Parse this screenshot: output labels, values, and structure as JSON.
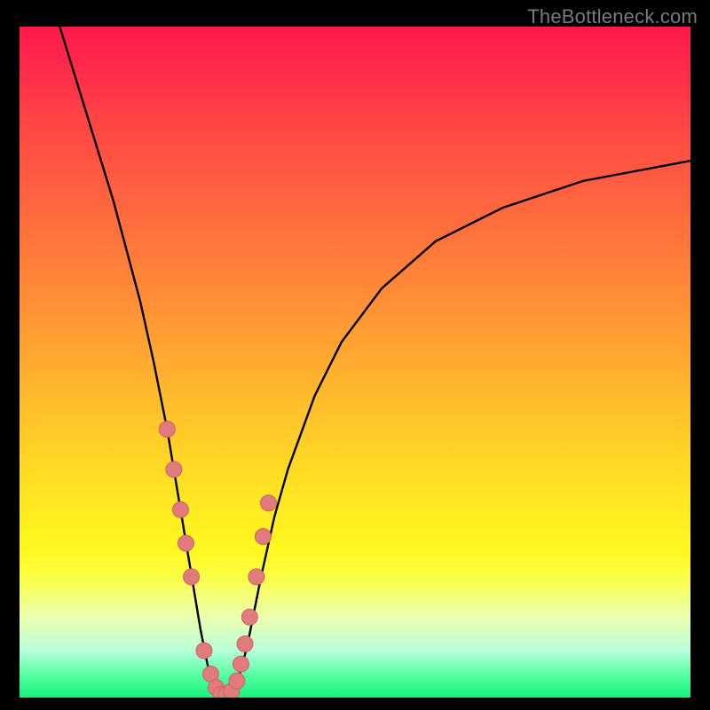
{
  "watermark": "TheBottleneck.com",
  "colors": {
    "marker_fill": "#e27b7d",
    "marker_stroke": "#cc6264",
    "curve_stroke": "#000000"
  },
  "chart_data": {
    "type": "line",
    "title": "",
    "xlabel": "",
    "ylabel": "",
    "xlim": [
      0,
      100
    ],
    "ylim": [
      0,
      100
    ],
    "grid": false,
    "series": [
      {
        "name": "curve",
        "x": [
          6,
          10,
          14,
          18,
          20,
          22,
          24,
          25,
          26,
          27,
          28,
          29,
          30,
          31,
          32,
          33,
          34,
          36,
          38,
          40,
          44,
          48,
          54,
          62,
          72,
          84,
          100
        ],
        "values": [
          100,
          87,
          74,
          59,
          50,
          40,
          28,
          22,
          16,
          10,
          5,
          2,
          0.5,
          0.5,
          1.5,
          4,
          8,
          18,
          27,
          34,
          45,
          53,
          61,
          68,
          73,
          77,
          80
        ]
      }
    ],
    "markers": {
      "name": "highlight-points",
      "x": [
        22.0,
        23.0,
        24.0,
        24.8,
        25.6,
        27.5,
        28.5,
        29.3,
        30.0,
        30.8,
        31.6,
        32.4,
        33.0,
        33.6,
        34.3,
        35.3,
        36.3,
        37.1
      ],
      "values": [
        40.0,
        34.0,
        28.0,
        23.0,
        18.0,
        7.0,
        3.5,
        1.5,
        0.5,
        0.5,
        1.0,
        2.5,
        5.0,
        8.0,
        12.0,
        18.0,
        24.0,
        29.0
      ],
      "r": 8
    }
  }
}
